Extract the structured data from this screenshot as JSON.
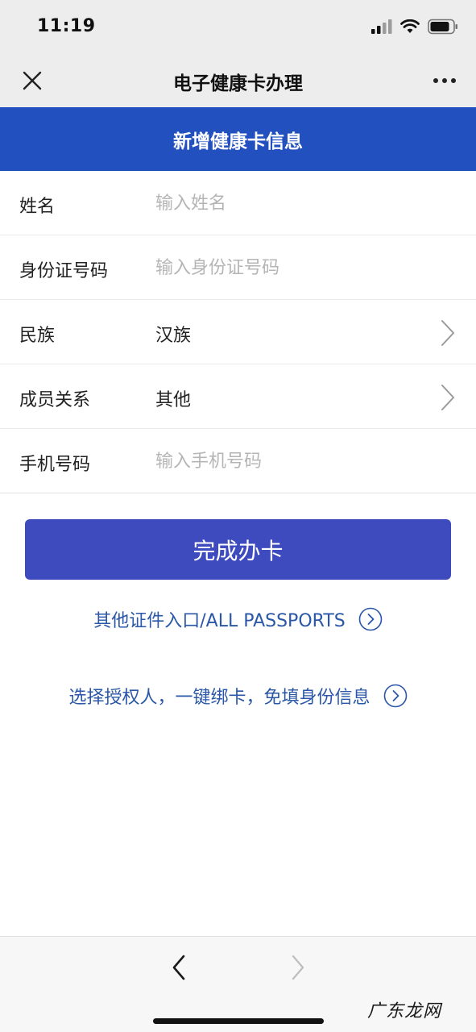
{
  "status_bar": {
    "time": "11:19",
    "icons": [
      "signal-icon",
      "wifi-icon",
      "battery-icon"
    ]
  },
  "nav": {
    "title": "电子健康卡办理",
    "close_icon": "close-icon",
    "more_icon": "more-icon"
  },
  "banner": {
    "title": "新增健康卡信息",
    "background": "#2350bf"
  },
  "form": {
    "name": {
      "label": "姓名",
      "placeholder": "输入姓名",
      "value": ""
    },
    "id_number": {
      "label": "身份证号码",
      "placeholder": "输入身份证号码",
      "value": ""
    },
    "ethnicity": {
      "label": "民族",
      "value": "汉族"
    },
    "relation": {
      "label": "成员关系",
      "value": "其他"
    },
    "phone": {
      "label": "手机号码",
      "placeholder": "输入手机号码",
      "value": ""
    }
  },
  "submit": {
    "label": "完成办卡",
    "color": "#3d4bbf"
  },
  "links": {
    "other_docs": "其他证件入口/ALL PASSPORTS",
    "authorize": "选择授权人，一键绑卡，免填身份信息",
    "color": "#2a57a8"
  },
  "bottom_nav": {
    "back_icon": "chevron-left-icon",
    "forward_icon": "chevron-right-icon"
  },
  "watermark": "广东龙网"
}
